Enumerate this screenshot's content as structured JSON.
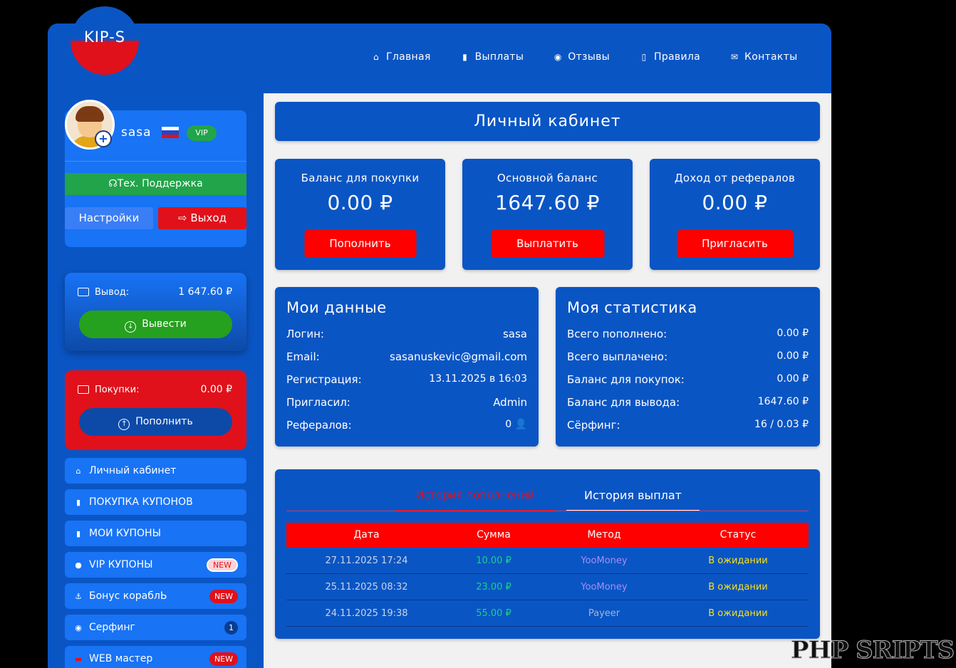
{
  "logo": {
    "text": "KIP-S"
  },
  "topnav": [
    {
      "icon": "⌂",
      "label": "Главная"
    },
    {
      "icon": "▮",
      "label": "Выплаты"
    },
    {
      "icon": "◉",
      "label": "Отзывы"
    },
    {
      "icon": "▯",
      "label": "Правила"
    },
    {
      "icon": "✉",
      "label": "Контакты"
    }
  ],
  "profile": {
    "username": "sasa",
    "vip": "VIP",
    "plus": "+",
    "support": "Тех. Поддержка",
    "settings": "Настройки",
    "logout": "Выход"
  },
  "withdraw": {
    "label": "Вывод:",
    "amount": "1 647.60 ₽",
    "button": "Вывести"
  },
  "purchases": {
    "label": "Покупки:",
    "amount": "0.00 ₽",
    "button": "Пополнить"
  },
  "side_menu": [
    {
      "icon": "⌂",
      "label": "Личный кабинет"
    },
    {
      "icon": "▮",
      "label": "ПОКУПКА КУПОНОВ"
    },
    {
      "icon": "▮",
      "label": "МОИ КУПОНЫ"
    },
    {
      "icon": "●",
      "label": "VIP КУПОНЫ",
      "badge": "NEW"
    },
    {
      "icon": "⚓",
      "label": "Бонус кораблЬ",
      "badge": "NEW"
    },
    {
      "icon": "◉",
      "label": "Серфинг",
      "badge": "1"
    },
    {
      "icon": "▬",
      "label": "WEB мастер",
      "badge": "NEW"
    }
  ],
  "page_title": "Личный кабинет",
  "balances": [
    {
      "title": "Баланс для покупки",
      "value": "0.00 ₽",
      "button": "Пополнить"
    },
    {
      "title": "Основной баланс",
      "value": "1647.60 ₽",
      "button": "Выплатить"
    },
    {
      "title": "Доход от рефералов",
      "value": "0.00 ₽",
      "button": "Пригласить"
    }
  ],
  "my_data": {
    "title": "Мои данные",
    "rows": [
      {
        "label": "Логин:",
        "value": "sasa"
      },
      {
        "label": "Email:",
        "value": "sasanuskevic@gmail.com"
      },
      {
        "label": "Регистрация:",
        "value": "13.11.2025 в 16:03"
      },
      {
        "label": "Пригласил:",
        "value": "Admin"
      },
      {
        "label": "Рефералов:",
        "value": "0 👤"
      }
    ]
  },
  "my_stats": {
    "title": "Моя статистика",
    "rows": [
      {
        "label": "Всего пополнено:",
        "value": "0.00 ₽"
      },
      {
        "label": "Всего выплачено:",
        "value": "0.00 ₽"
      },
      {
        "label": "Баланс для покупок:",
        "value": "0.00 ₽"
      },
      {
        "label": "Баланс для вывода:",
        "value": "1647.60 ₽"
      },
      {
        "label": "Сёрфинг:",
        "value": "16 / 0.03 ₽"
      }
    ]
  },
  "history": {
    "tabs": [
      "История пополнений",
      "История выплат"
    ],
    "columns": [
      "Дата",
      "Сумма",
      "Метод",
      "Статус"
    ],
    "rows": [
      {
        "date": "27.11.2025 17:24",
        "amount": "10.00 ₽",
        "method": "YooMoney",
        "status": "В ожидании"
      },
      {
        "date": "25.11.2025 08:32",
        "amount": "23.00 ₽",
        "method": "YooMoney",
        "status": "В ожидании"
      },
      {
        "date": "24.11.2025 19:38",
        "amount": "55.00 ₽",
        "method": "Payeer",
        "status": "В ожидании"
      }
    ]
  },
  "watermark": "PHP SRIPTS",
  "colors": {
    "brand_blue": "#0a55c4",
    "accent_red": "#fe0000",
    "success_green": "#22a44a"
  }
}
